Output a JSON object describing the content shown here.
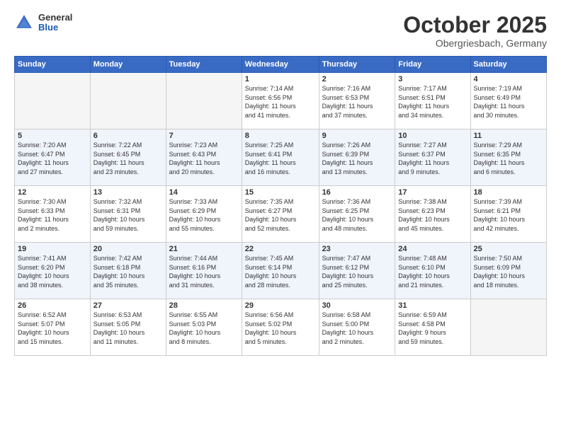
{
  "header": {
    "logo": {
      "general": "General",
      "blue": "Blue"
    },
    "title": "October 2025",
    "location": "Obergriesbach, Germany"
  },
  "weekdays": [
    "Sunday",
    "Monday",
    "Tuesday",
    "Wednesday",
    "Thursday",
    "Friday",
    "Saturday"
  ],
  "weeks": [
    [
      {
        "day": "",
        "info": ""
      },
      {
        "day": "",
        "info": ""
      },
      {
        "day": "",
        "info": ""
      },
      {
        "day": "1",
        "info": "Sunrise: 7:14 AM\nSunset: 6:56 PM\nDaylight: 11 hours\nand 41 minutes."
      },
      {
        "day": "2",
        "info": "Sunrise: 7:16 AM\nSunset: 6:53 PM\nDaylight: 11 hours\nand 37 minutes."
      },
      {
        "day": "3",
        "info": "Sunrise: 7:17 AM\nSunset: 6:51 PM\nDaylight: 11 hours\nand 34 minutes."
      },
      {
        "day": "4",
        "info": "Sunrise: 7:19 AM\nSunset: 6:49 PM\nDaylight: 11 hours\nand 30 minutes."
      }
    ],
    [
      {
        "day": "5",
        "info": "Sunrise: 7:20 AM\nSunset: 6:47 PM\nDaylight: 11 hours\nand 27 minutes."
      },
      {
        "day": "6",
        "info": "Sunrise: 7:22 AM\nSunset: 6:45 PM\nDaylight: 11 hours\nand 23 minutes."
      },
      {
        "day": "7",
        "info": "Sunrise: 7:23 AM\nSunset: 6:43 PM\nDaylight: 11 hours\nand 20 minutes."
      },
      {
        "day": "8",
        "info": "Sunrise: 7:25 AM\nSunset: 6:41 PM\nDaylight: 11 hours\nand 16 minutes."
      },
      {
        "day": "9",
        "info": "Sunrise: 7:26 AM\nSunset: 6:39 PM\nDaylight: 11 hours\nand 13 minutes."
      },
      {
        "day": "10",
        "info": "Sunrise: 7:27 AM\nSunset: 6:37 PM\nDaylight: 11 hours\nand 9 minutes."
      },
      {
        "day": "11",
        "info": "Sunrise: 7:29 AM\nSunset: 6:35 PM\nDaylight: 11 hours\nand 6 minutes."
      }
    ],
    [
      {
        "day": "12",
        "info": "Sunrise: 7:30 AM\nSunset: 6:33 PM\nDaylight: 11 hours\nand 2 minutes."
      },
      {
        "day": "13",
        "info": "Sunrise: 7:32 AM\nSunset: 6:31 PM\nDaylight: 10 hours\nand 59 minutes."
      },
      {
        "day": "14",
        "info": "Sunrise: 7:33 AM\nSunset: 6:29 PM\nDaylight: 10 hours\nand 55 minutes."
      },
      {
        "day": "15",
        "info": "Sunrise: 7:35 AM\nSunset: 6:27 PM\nDaylight: 10 hours\nand 52 minutes."
      },
      {
        "day": "16",
        "info": "Sunrise: 7:36 AM\nSunset: 6:25 PM\nDaylight: 10 hours\nand 48 minutes."
      },
      {
        "day": "17",
        "info": "Sunrise: 7:38 AM\nSunset: 6:23 PM\nDaylight: 10 hours\nand 45 minutes."
      },
      {
        "day": "18",
        "info": "Sunrise: 7:39 AM\nSunset: 6:21 PM\nDaylight: 10 hours\nand 42 minutes."
      }
    ],
    [
      {
        "day": "19",
        "info": "Sunrise: 7:41 AM\nSunset: 6:20 PM\nDaylight: 10 hours\nand 38 minutes."
      },
      {
        "day": "20",
        "info": "Sunrise: 7:42 AM\nSunset: 6:18 PM\nDaylight: 10 hours\nand 35 minutes."
      },
      {
        "day": "21",
        "info": "Sunrise: 7:44 AM\nSunset: 6:16 PM\nDaylight: 10 hours\nand 31 minutes."
      },
      {
        "day": "22",
        "info": "Sunrise: 7:45 AM\nSunset: 6:14 PM\nDaylight: 10 hours\nand 28 minutes."
      },
      {
        "day": "23",
        "info": "Sunrise: 7:47 AM\nSunset: 6:12 PM\nDaylight: 10 hours\nand 25 minutes."
      },
      {
        "day": "24",
        "info": "Sunrise: 7:48 AM\nSunset: 6:10 PM\nDaylight: 10 hours\nand 21 minutes."
      },
      {
        "day": "25",
        "info": "Sunrise: 7:50 AM\nSunset: 6:09 PM\nDaylight: 10 hours\nand 18 minutes."
      }
    ],
    [
      {
        "day": "26",
        "info": "Sunrise: 6:52 AM\nSunset: 5:07 PM\nDaylight: 10 hours\nand 15 minutes."
      },
      {
        "day": "27",
        "info": "Sunrise: 6:53 AM\nSunset: 5:05 PM\nDaylight: 10 hours\nand 11 minutes."
      },
      {
        "day": "28",
        "info": "Sunrise: 6:55 AM\nSunset: 5:03 PM\nDaylight: 10 hours\nand 8 minutes."
      },
      {
        "day": "29",
        "info": "Sunrise: 6:56 AM\nSunset: 5:02 PM\nDaylight: 10 hours\nand 5 minutes."
      },
      {
        "day": "30",
        "info": "Sunrise: 6:58 AM\nSunset: 5:00 PM\nDaylight: 10 hours\nand 2 minutes."
      },
      {
        "day": "31",
        "info": "Sunrise: 6:59 AM\nSunset: 4:58 PM\nDaylight: 9 hours\nand 59 minutes."
      },
      {
        "day": "",
        "info": ""
      }
    ]
  ]
}
